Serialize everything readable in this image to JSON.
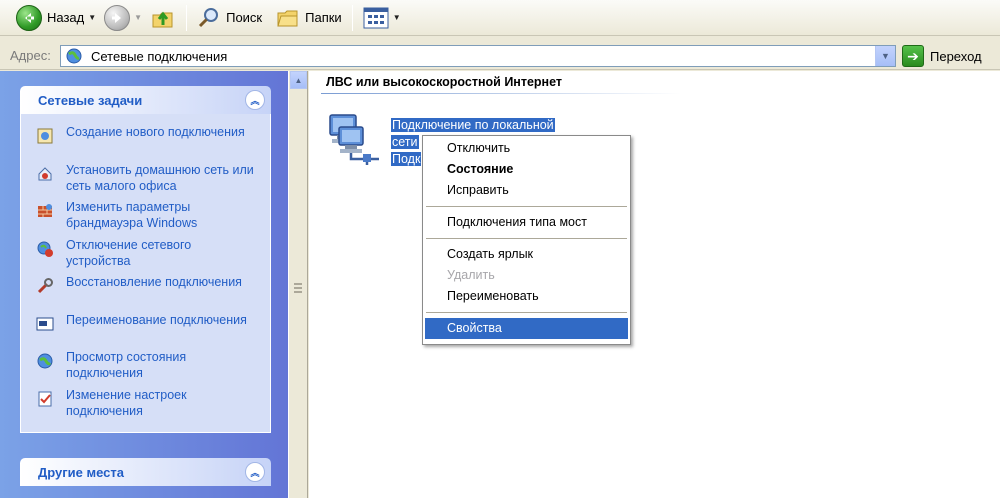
{
  "toolbar": {
    "back_label": "Назад",
    "search_label": "Поиск",
    "folders_label": "Папки"
  },
  "address": {
    "label": "Адрес:",
    "value": "Сетевые подключения",
    "go_label": "Переход"
  },
  "network_tasks": {
    "title": "Сетевые задачи",
    "items": [
      {
        "label": "Создание нового подключения",
        "icon": "new-connection-icon"
      },
      {
        "label": "Установить домашнюю сеть или сеть малого офиса",
        "icon": "home-network-icon"
      },
      {
        "label": "Изменить параметры брандмауэра Windows",
        "icon": "firewall-icon"
      },
      {
        "label": "Отключение сетевого устройства",
        "icon": "disable-device-icon"
      },
      {
        "label": "Восстановление подключения",
        "icon": "repair-icon"
      },
      {
        "label": "Переименование подключения",
        "icon": "rename-icon"
      },
      {
        "label": "Просмотр состояния подключения",
        "icon": "status-icon"
      },
      {
        "label": "Изменение настроек подключения",
        "icon": "settings-icon"
      }
    ]
  },
  "other_places": {
    "title": "Другие места"
  },
  "main": {
    "group_title": "ЛВС или высокоскоростной Интернет",
    "connection": {
      "line1": "Подключение по локальной",
      "line2": "сети",
      "line3": "Подк"
    }
  },
  "context_menu": {
    "items": [
      {
        "label": "Отключить"
      },
      {
        "label": "Состояние"
      },
      {
        "label": "Исправить"
      },
      {
        "label": "Подключения типа мост"
      },
      {
        "label": "Создать ярлык"
      },
      {
        "label": "Удалить"
      },
      {
        "label": "Переименовать"
      },
      {
        "label": "Свойства"
      }
    ]
  }
}
